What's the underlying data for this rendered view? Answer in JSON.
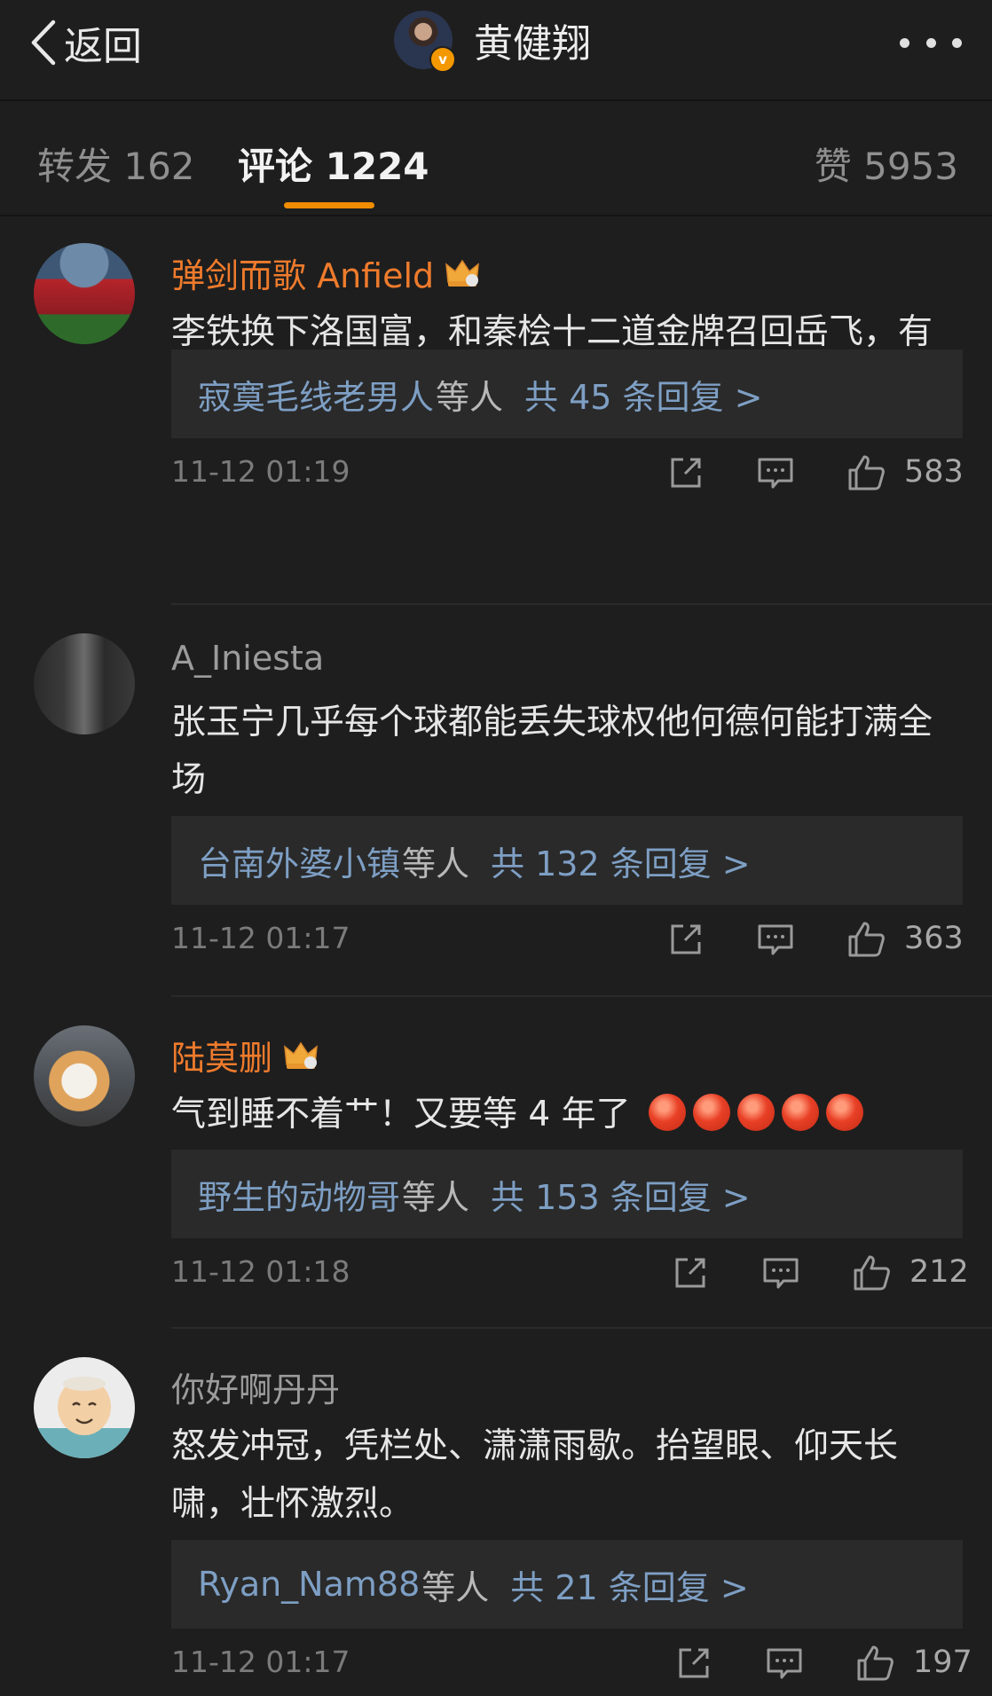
{
  "header": {
    "back_label": "返回",
    "title": "黄健翔",
    "verified_badge": "v"
  },
  "tabs": {
    "repost": "转发 162",
    "comment": "评论 1224",
    "like": "赞 5953"
  },
  "colors": {
    "background": "#1e1e1e",
    "accent": "#f08c00",
    "vip_name": "#ef7b2c",
    "link": "#7e9fc4"
  },
  "comments": [
    {
      "username": "弹剑而歌 Anfield",
      "vip": true,
      "crown_level": "6",
      "text": "李铁换下洛国富，和秦桧十二道金牌召回岳飞，有异曲同工之妙...",
      "reply_names": "寂寞毛线老男人",
      "reply_suffix": "等人",
      "reply_count": "共 45 条回复 >",
      "timestamp": "11-12 01:19",
      "likes": "583"
    },
    {
      "username": "A_Iniesta",
      "vip": false,
      "text": "张玉宁几乎每个球都能丢失球权他何德何能打满全场",
      "reply_names": "台南外婆小镇",
      "reply_suffix": "等人",
      "reply_count": "共 132 条回复 >",
      "timestamp": "11-12 01:17",
      "likes": "363"
    },
    {
      "username": "陆莫删",
      "vip": true,
      "crown_level": "3",
      "text": "气到睡不着艹！又要等 4 年了",
      "emoji_count": 5,
      "reply_names": "野生的动物哥",
      "reply_suffix": "等人",
      "reply_count": "共 153 条回复 >",
      "timestamp": "11-12 01:18",
      "likes": "212"
    },
    {
      "username": "你好啊丹丹",
      "vip": false,
      "text": "怒发冲冠，凭栏处、潇潇雨歇。抬望眼、仰天长啸，壮怀激烈。",
      "reply_names": "Ryan_Nam88",
      "reply_suffix": "等人",
      "reply_count": "共 21 条回复 >",
      "timestamp": "11-12 01:17",
      "likes": "197"
    }
  ]
}
